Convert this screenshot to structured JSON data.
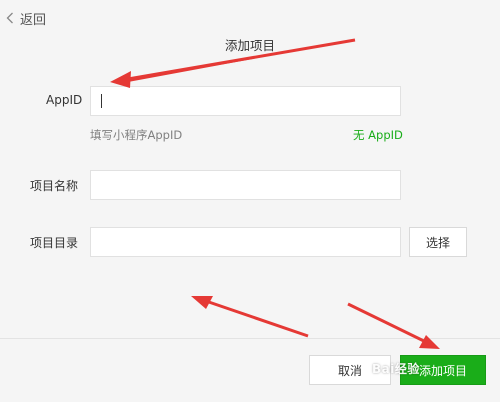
{
  "header": {
    "back_label": "返回",
    "title": "添加项目"
  },
  "form": {
    "appid_label": "AppID",
    "appid_value": "",
    "appid_hint": "填写小程序AppID",
    "no_appid_link": "无 AppID",
    "project_name_label": "项目名称",
    "project_name_value": "",
    "project_dir_label": "项目目录",
    "project_dir_value": "",
    "choose_button": "选择"
  },
  "footer": {
    "cancel_button": "取消",
    "confirm_button": "添加项目"
  },
  "watermark": "Bai经验",
  "colors": {
    "accent_green": "#1aad19",
    "annotation_red": "#e53935"
  }
}
